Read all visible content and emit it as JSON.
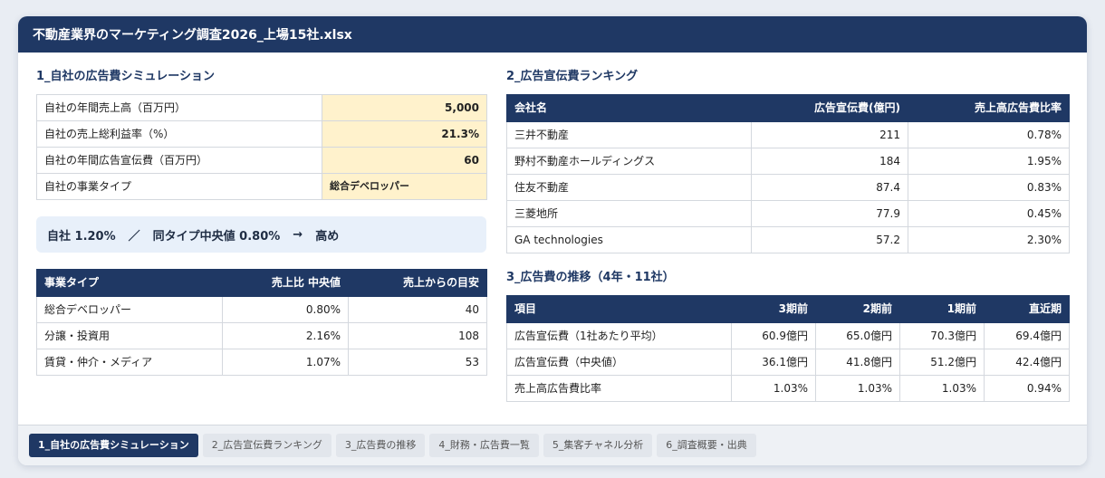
{
  "window": {
    "title": "不動産業界のマーケティング調査2026_上場15社.xlsx"
  },
  "sim": {
    "title": "1_自社の広告費シミュレーション",
    "rows": [
      {
        "label": "自社の年間売上高（百万円）",
        "value": "5,000"
      },
      {
        "label": "自社の売上総利益率（%）",
        "value": "21.3%"
      },
      {
        "label": "自社の年間広告宣伝費（百万円）",
        "value": "60"
      },
      {
        "label": "自社の事業タイプ",
        "value": "総合デベロッパー"
      }
    ],
    "summary": {
      "self": "自社 1.20%",
      "sep": "／",
      "median": "同タイプ中央値 0.80%",
      "arrow": "→",
      "verdict": "高め"
    },
    "type_table": {
      "headers": [
        "事業タイプ",
        "売上比 中央値",
        "売上からの目安"
      ],
      "rows": [
        [
          "総合デベロッパー",
          "0.80%",
          "40"
        ],
        [
          "分譲・投資用",
          "2.16%",
          "108"
        ],
        [
          "賃貸・仲介・メディア",
          "1.07%",
          "53"
        ]
      ]
    }
  },
  "ranking": {
    "title": "2_広告宣伝費ランキング",
    "headers": [
      "会社名",
      "広告宣伝費(億円)",
      "売上高広告費比率"
    ],
    "rows": [
      [
        "三井不動産",
        "211",
        "0.78%"
      ],
      [
        "野村不動産ホールディングス",
        "184",
        "1.95%"
      ],
      [
        "住友不動産",
        "87.4",
        "0.83%"
      ],
      [
        "三菱地所",
        "77.9",
        "0.45%"
      ],
      [
        "GA technologies",
        "57.2",
        "2.30%"
      ]
    ]
  },
  "trend": {
    "title": "3_広告費の推移（4年・11社）",
    "headers": [
      "項目",
      "3期前",
      "2期前",
      "1期前",
      "直近期"
    ],
    "rows": [
      [
        "広告宣伝費（1社あたり平均）",
        "60.9億円",
        "65.0億円",
        "70.3億円",
        "69.4億円"
      ],
      [
        "広告宣伝費（中央値）",
        "36.1億円",
        "41.8億円",
        "51.2億円",
        "42.4億円"
      ],
      [
        "売上高広告費比率",
        "1.03%",
        "1.03%",
        "1.03%",
        "0.94%"
      ]
    ]
  },
  "tabs": [
    {
      "label": "1_自社の広告費シミュレーション",
      "active": true
    },
    {
      "label": "2_広告宣伝費ランキング",
      "active": false
    },
    {
      "label": "3_広告費の推移",
      "active": false
    },
    {
      "label": "4_財務・広告費一覧",
      "active": false
    },
    {
      "label": "5_集客チャネル分析",
      "active": false
    },
    {
      "label": "6_調査概要・出典",
      "active": false
    }
  ],
  "colors": {
    "header": "#1f3864",
    "input": "#fff2cc",
    "summary_bg": "#e8f0fa"
  }
}
